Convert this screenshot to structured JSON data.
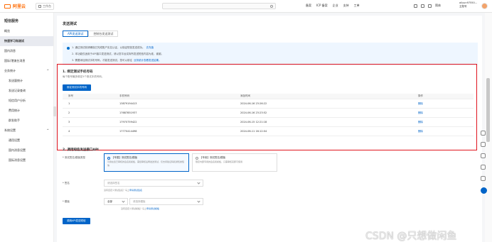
{
  "topbar": {
    "logo_text": "阿里云",
    "workbench": "工作台",
    "links": [
      "备案",
      "ICP 备案",
      "企业",
      "支持",
      "工单",
      "简体"
    ],
    "user_name": "aliyun97550...",
    "user_sub": "主账号"
  },
  "sidebar": {
    "title": "短信服务",
    "items": [
      "概览",
      "快速学习和测试",
      "国内消息",
      "国际/港澳台消息"
    ],
    "groups": [
      {
        "label": "业务统计",
        "children": [
          "发送量统计",
          "发送记录查询",
          "短信用户分析",
          "费用统计",
          "群发助手"
        ]
      },
      {
        "label": "系统设置",
        "children": [
          "通用设置",
          "国内消息设置",
          "国际消息设置"
        ]
      }
    ]
  },
  "main": {
    "title": "发送测试",
    "tabs": [
      "API发送测试",
      "控制台发送测试"
    ],
    "notices": [
      {
        "text": "1. 通过测试前请确保已完成账户实名认证，以保证短信发送成功。",
        "link": "去充值"
      },
      {
        "text": "2. 本功能仅适用于API接口发送测试，请以您平台实际所发送短信内容为准，谢谢。",
        "link": ""
      },
      {
        "text": "3. 需要添加测试手机号码，才能发送测试，您可以前往",
        "link": "业务统计查看发送结果。"
      }
    ],
    "section1": {
      "title": "1. 绑定测试手机号码",
      "subtitle": "每个账号最多绑定5个测试手机号码。",
      "button": "绑定测试手机号码",
      "columns": [
        "序号",
        "手机号码",
        "添加时间",
        "操作"
      ],
      "rows": [
        {
          "no": "1",
          "phone": "13879194413",
          "time": "2024-06-16 23:26:22",
          "op": "删除"
        },
        {
          "no": "2",
          "phone": "17687851937",
          "time": "2024-06-16 23:23:52",
          "op": "删除"
        },
        {
          "no": "3",
          "phone": "17970759422",
          "time": "2024-06-15 12:21:18",
          "op": "删除"
        },
        {
          "no": "4",
          "phone": "17770414498",
          "time": "2024-06-11 16:12:04",
          "op": "删除"
        }
      ]
    },
    "section2": {
      "title": "2. 调用短信发送接口API",
      "label_type": "* 测试签名/模板类型",
      "card1_title": "【专属】测试签名/模板",
      "card1_desc": "可用在您已审核的签名和模板，需经审核后再发送测试，仅支持验证码和通知类短信",
      "card2_title": "【专用】测试签名/模板",
      "card2_desc": "限定内部专用的签名和模板，只需审核完即可使用",
      "label_sign": "* 签名",
      "sign_placeholder": "请选择签名",
      "sign_hint": "没有自定义测试签名？马上",
      "sign_hint_link": "申请测试签名",
      "label_template": "* 模板",
      "template_filter": "全部",
      "template_placeholder": "请选择模板",
      "template_hint": "没有自定义测试模板？马上",
      "template_hint_link": "申请测试模板",
      "submit": "调用API发送短信"
    }
  },
  "watermark": "CSDN @只想做闲鱼"
}
